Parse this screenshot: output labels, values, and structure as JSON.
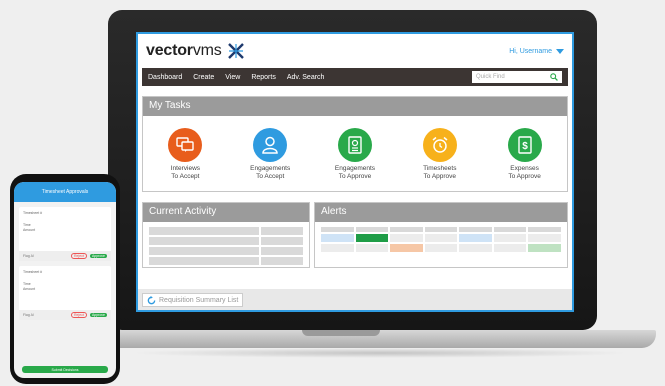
{
  "app": {
    "logo_bold": "vector",
    "logo_light": "vms",
    "user_greeting": "Hi, Username"
  },
  "nav": {
    "items": [
      {
        "label": "Dashboard"
      },
      {
        "label": "Create"
      },
      {
        "label": "View"
      },
      {
        "label": "Reports"
      },
      {
        "label": "Adv. Search"
      }
    ],
    "search_placeholder": "Quick Find"
  },
  "my_tasks": {
    "title": "My Tasks",
    "items": [
      {
        "line1": "Interviews",
        "line2": "To Accept",
        "color": "#e85d1c",
        "icon": "chat-icon"
      },
      {
        "line1": "Engagements",
        "line2": "To Accept",
        "color": "#2f9be0",
        "icon": "user-icon"
      },
      {
        "line1": "Engagements",
        "line2": "To Approve",
        "color": "#29a94a",
        "icon": "id-badge-icon"
      },
      {
        "line1": "Timesheets",
        "line2": "To Approve",
        "color": "#f7b11b",
        "icon": "alarm-clock-icon"
      },
      {
        "line1": "Expenses",
        "line2": "To Approve",
        "color": "#29a94a",
        "icon": "dollar-icon"
      }
    ]
  },
  "current_activity": {
    "title": "Current Activity"
  },
  "alerts": {
    "title": "Alerts",
    "highlight_colors": {
      "blue": "#cfe3f6",
      "green": "#1f9d47",
      "orange": "#f6c7a6",
      "light_green": "#bfe2c2"
    }
  },
  "footer": {
    "requisition_link": "Requisition Summary List"
  },
  "mobile": {
    "header_title": "Timesheet Approvals",
    "cards": [
      {
        "label": "Timesheet #",
        "time_label": "Time",
        "amount_label": "Amount",
        "flag_label": "Flag Al",
        "reject_label": "Reject",
        "approve_label": "Approve"
      },
      {
        "label": "Timesheet #",
        "time_label": "Time",
        "amount_label": "Amount",
        "flag_label": "Flag Al",
        "reject_label": "Reject",
        "approve_label": "Approve"
      }
    ],
    "submit_label": "Submit Decisions"
  }
}
